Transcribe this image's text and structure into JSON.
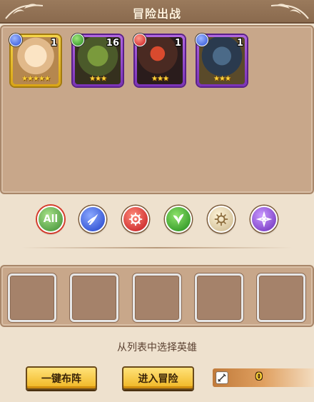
{
  "header": {
    "title": "冒险出战"
  },
  "roster": [
    {
      "element": "water-icon",
      "level": "1",
      "stars": "★★★★★",
      "frame": "gold"
    },
    {
      "element": "wood-icon",
      "level": "16",
      "stars": "★★★",
      "frame": "purple"
    },
    {
      "element": "fire-icon",
      "level": "1",
      "stars": "★★★",
      "frame": "purple"
    },
    {
      "element": "water-icon",
      "level": "1",
      "stars": "★★★",
      "frame": "purple"
    }
  ],
  "filters": [
    {
      "label": "All",
      "icon": "all-icon"
    },
    {
      "label": "",
      "icon": "water-element-icon"
    },
    {
      "label": "",
      "icon": "fire-element-icon"
    },
    {
      "label": "",
      "icon": "wood-element-icon"
    },
    {
      "label": "",
      "icon": "light-element-icon"
    },
    {
      "label": "",
      "icon": "dark-element-icon"
    }
  ],
  "team": {
    "slots": 5
  },
  "hint": "从列表中选择英雄",
  "buttons": {
    "auto_deploy": "一键布阵",
    "enter_adventure": "进入冒险"
  },
  "power": {
    "icon": "sword-power-icon",
    "value": "0"
  },
  "colors": {
    "gold_frame": "#f5d64a",
    "purple_frame": "#9a4ad0",
    "button": "#ffd24a"
  }
}
